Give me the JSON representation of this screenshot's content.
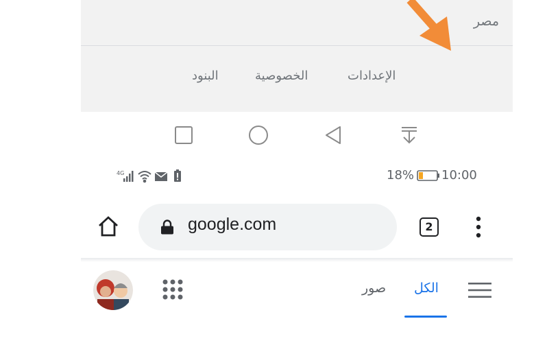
{
  "footer": {
    "country": "مصر",
    "links": {
      "settings": "الإعدادات",
      "privacy": "الخصوصية",
      "terms": "البنود"
    }
  },
  "navbar": {
    "icons": [
      "recents-square-icon",
      "home-circle-icon",
      "back-triangle-icon",
      "notification-pull-icon"
    ]
  },
  "statusbar": {
    "network": "4G",
    "battery_percent": "18%",
    "time": "10:00"
  },
  "toolbar": {
    "url": "google.com",
    "tab_count": "2"
  },
  "google_header": {
    "tabs": {
      "all": "الكل",
      "images": "صور"
    }
  },
  "colors": {
    "accent_blue": "#1a73e8",
    "annotation_arrow": "#f28c38",
    "battery_low": "#f5a623"
  }
}
